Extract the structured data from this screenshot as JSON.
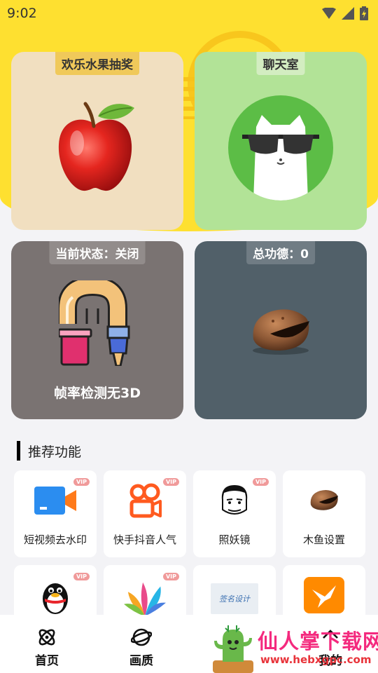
{
  "status_bar": {
    "time": "9:02"
  },
  "cards": {
    "fruit": {
      "tag": "欢乐水果抽奖"
    },
    "chat": {
      "tag": "聊天室"
    },
    "status": {
      "tag": "当前状态：关闭",
      "text": "帧率检测无3D"
    },
    "merit": {
      "tag": "总功德：0"
    }
  },
  "section": {
    "title": "推荐功能"
  },
  "tiles": [
    {
      "label": "短视频去水印",
      "vip": "VIP",
      "icon": "video-camera-icon"
    },
    {
      "label": "快手抖音人气",
      "vip": "VIP",
      "icon": "kuaishou-icon"
    },
    {
      "label": "照妖镜",
      "vip": "VIP",
      "icon": "meme-face-icon"
    },
    {
      "label": "木鱼设置",
      "vip": "",
      "icon": "wooden-fish-icon"
    },
    {
      "label": "",
      "vip": "VIP",
      "icon": "qq-penguin-icon"
    },
    {
      "label": "",
      "vip": "VIP",
      "icon": "petals-icon"
    },
    {
      "label": "",
      "vip": "",
      "icon": "signature-design-icon",
      "image_text": "签名设计"
    },
    {
      "label": "",
      "vip": "",
      "icon": "hummingbird-icon"
    }
  ],
  "tabbar": {
    "home": "首页",
    "quality": "画质",
    "mine": "我的"
  },
  "watermark": {
    "title": "仙人掌下载网",
    "url": "www.hebxgpc.com"
  },
  "colors": {
    "accent_yellow": "#fee030",
    "fruit_card": "#f1dfc0",
    "chat_card": "#b2e397",
    "status_card": "#7a7372",
    "merit_card": "#516069",
    "vip_badge": "#f09a9a"
  }
}
